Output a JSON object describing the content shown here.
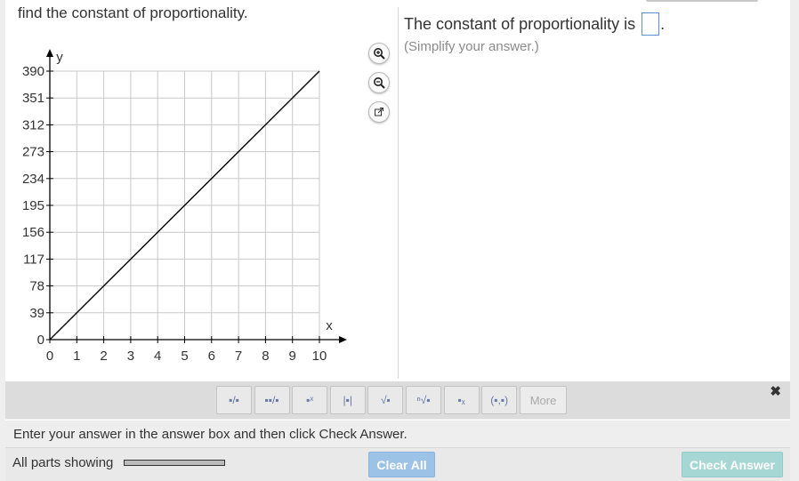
{
  "question": {
    "text": "find the constant of proportionality."
  },
  "answer": {
    "prefix": "The constant of proportionality is",
    "suffix": ".",
    "hint": "(Simplify your answer.)",
    "value": ""
  },
  "graph_tools": {
    "zoom_in_icon": "zoom-in-icon",
    "zoom_out_icon": "zoom-out-icon",
    "popout_icon": "external-link-icon"
  },
  "chart_data": {
    "type": "line",
    "title": "",
    "xlabel": "x",
    "ylabel": "y",
    "xlim": [
      0,
      10
    ],
    "ylim": [
      0,
      390
    ],
    "xticks": [
      "0",
      "1",
      "2",
      "3",
      "4",
      "5",
      "6",
      "7",
      "8",
      "9",
      "10"
    ],
    "yticks": [
      "0",
      "39",
      "78",
      "117",
      "156",
      "195",
      "234",
      "273",
      "312",
      "351",
      "390"
    ],
    "grid": true,
    "series": [
      {
        "x": [
          0,
          10
        ],
        "y": [
          0,
          390
        ],
        "color": "#000000"
      }
    ]
  },
  "toolbar": {
    "buttons": [
      {
        "name": "fraction-template-button",
        "glyph": "▪/▪"
      },
      {
        "name": "mixed-number-template-button",
        "glyph": "▪▪/▪"
      },
      {
        "name": "exponent-template-button",
        "glyph": "▪ˣ"
      },
      {
        "name": "absolute-value-template-button",
        "glyph": "|▪|"
      },
      {
        "name": "square-root-template-button",
        "glyph": "√▪"
      },
      {
        "name": "nth-root-template-button",
        "glyph": "ⁿ√▪"
      },
      {
        "name": "subscript-template-button",
        "glyph": "▪ₓ"
      },
      {
        "name": "ordered-pair-template-button",
        "glyph": "(▪,▪)"
      }
    ],
    "more_label": "More",
    "close_glyph": "✖"
  },
  "instruction": "Enter your answer in the answer box and then click Check Answer.",
  "status": {
    "parts_label": "All parts showing",
    "progress": 1.0,
    "clear_all_label": "Clear All",
    "check_answer_label": "Check Answer"
  },
  "colors": {
    "grid": "#c8c8c8",
    "axis": "#000000",
    "answer_box_border": "#5b8fd6",
    "clear_all_bg": "#9cc2e6",
    "check_answer_bg": "#a7d7d4"
  }
}
